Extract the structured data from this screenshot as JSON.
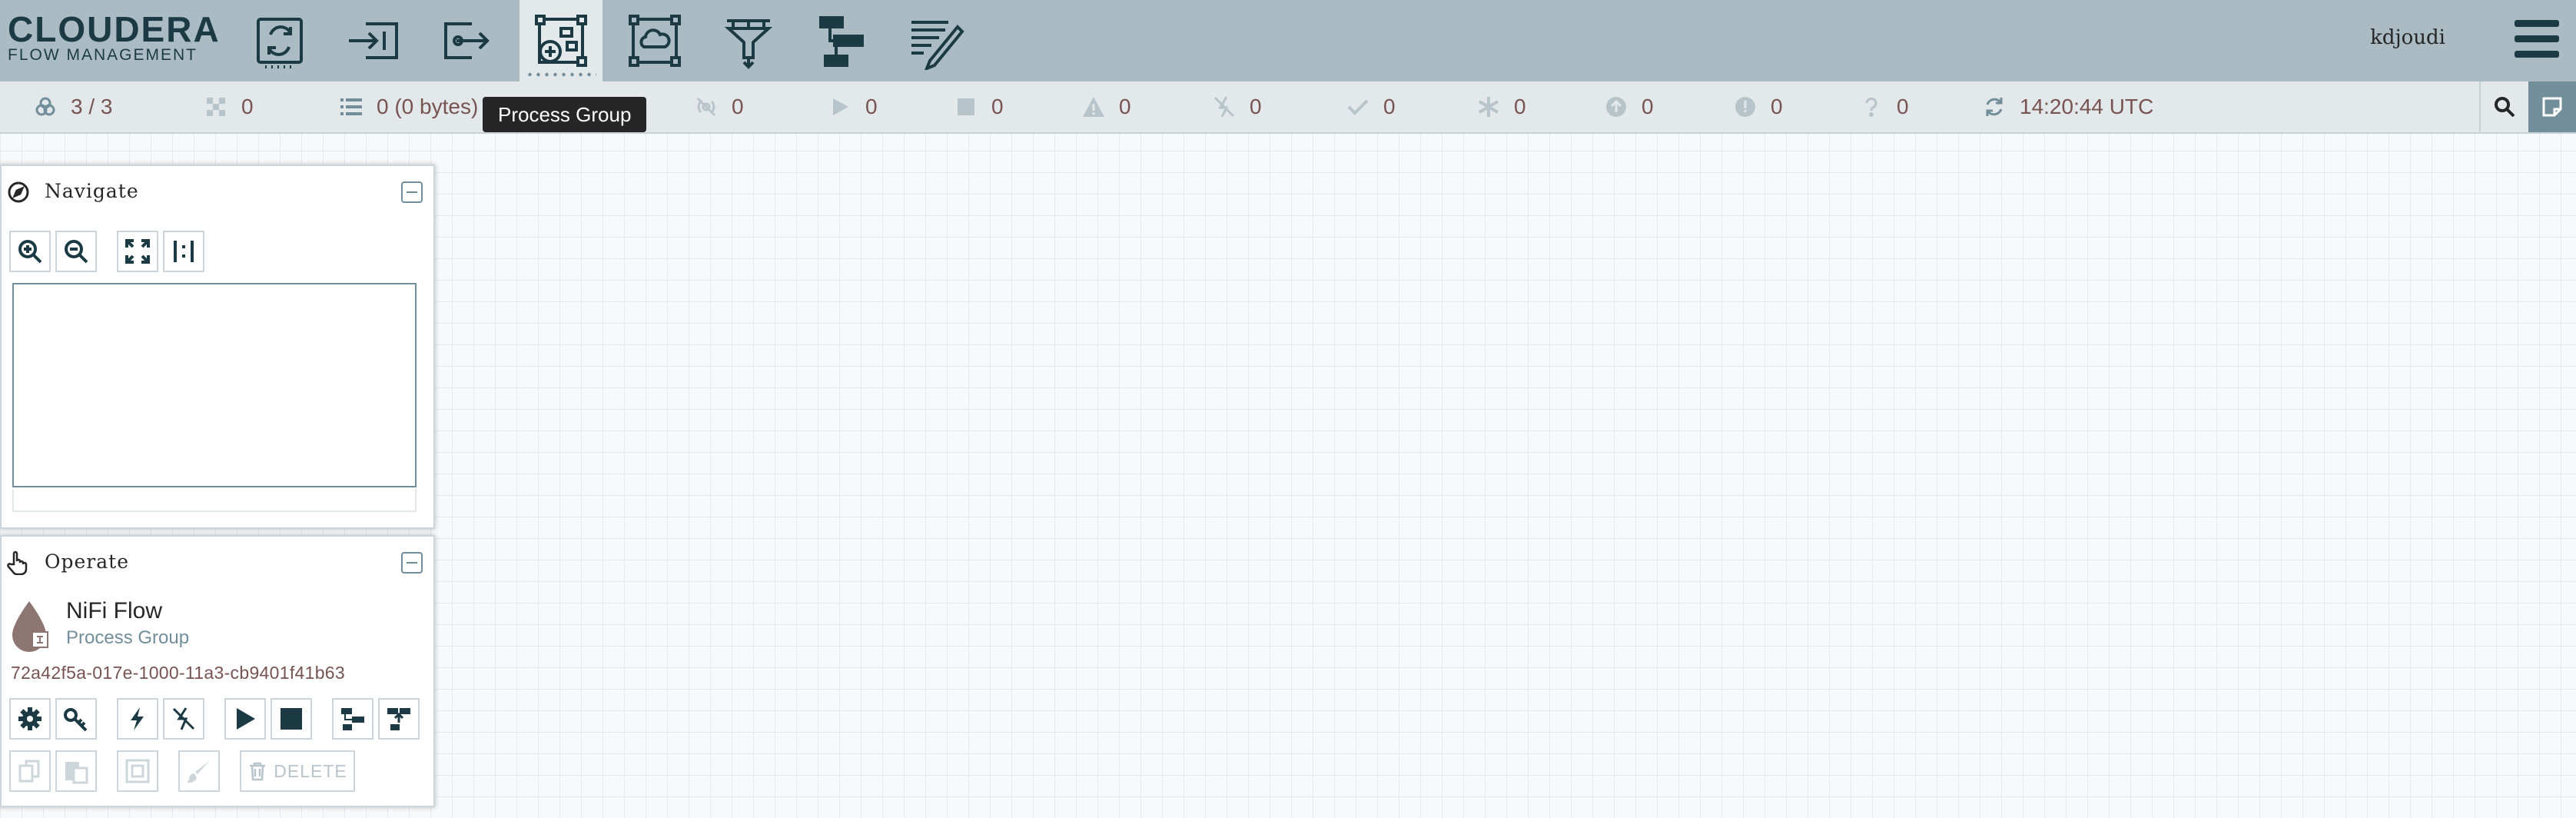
{
  "header": {
    "logo_brand": "CLOUDERA",
    "logo_product": "FLOW MANAGEMENT",
    "tools": [
      {
        "icon": "processor-icon"
      },
      {
        "icon": "input-port-icon"
      },
      {
        "icon": "output-port-icon"
      },
      {
        "icon": "process-group-icon",
        "active": true
      },
      {
        "icon": "remote-process-group-icon"
      },
      {
        "icon": "funnel-icon"
      },
      {
        "icon": "template-icon"
      },
      {
        "icon": "label-icon"
      }
    ],
    "user": "kdjoudi"
  },
  "tooltip": "Process Group",
  "status": {
    "nodes": "3 / 3",
    "active_threads": "0",
    "queued": "0 (0 bytes)",
    "transmitting": "0",
    "not_transmitting": "0",
    "running": "0",
    "stopped": "0",
    "invalid": "0",
    "disabled": "0",
    "up_to_date": "0",
    "locally_modified": "0",
    "stale": "0",
    "locally_modified_and_stale": "0",
    "sync_failure": "0",
    "refresh_time": "14:20:44 UTC"
  },
  "navigate": {
    "title": "Navigate"
  },
  "operate": {
    "title": "Operate",
    "name": "NiFi Flow",
    "type": "Process Group",
    "id": "72a42f5a-017e-1000-11a3-cb9401f41b63",
    "delete_label": "DELETE"
  },
  "colors": {
    "header_bg": "#aabbc3",
    "icon_dark": "#1c3a44",
    "status_bg": "#e3e8eb",
    "value_text": "#775351"
  }
}
